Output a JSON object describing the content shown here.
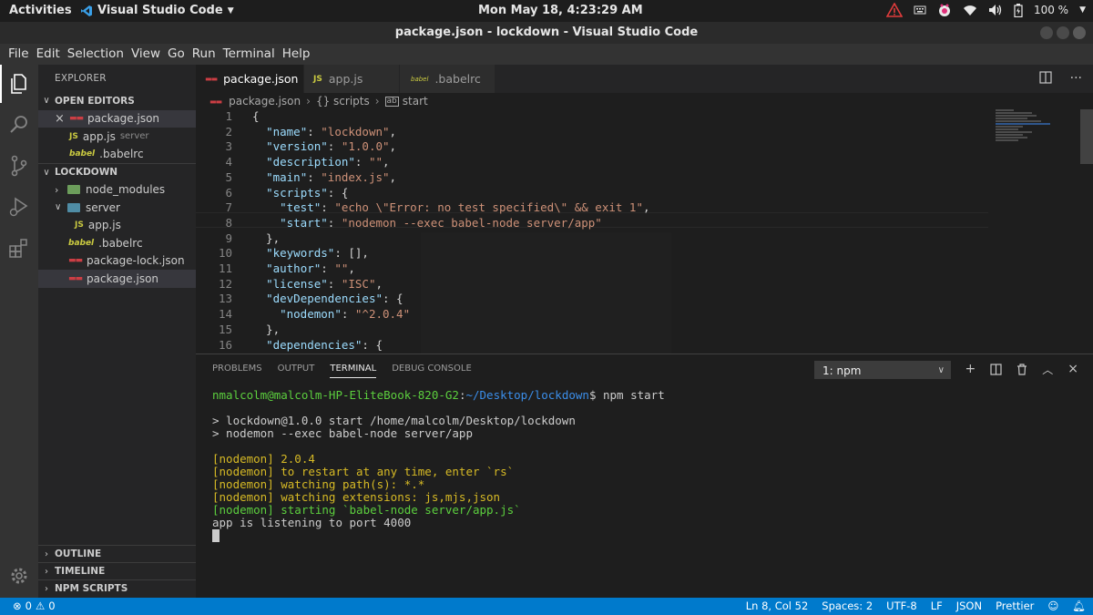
{
  "system": {
    "activities": "Activities",
    "app_name": "Visual Studio Code",
    "clock": "Mon May 18,  4:23:29 AM",
    "battery": "100 %"
  },
  "window": {
    "title": "package.json - lockdown - Visual Studio Code"
  },
  "menu": [
    "File",
    "Edit",
    "Selection",
    "View",
    "Go",
    "Run",
    "Terminal",
    "Help"
  ],
  "sidebar": {
    "title": "EXPLORER",
    "open_editors": {
      "header": "OPEN EDITORS",
      "items": [
        {
          "name": "package.json",
          "desc": ""
        },
        {
          "name": "app.js",
          "desc": "server"
        },
        {
          "name": ".babelrc",
          "desc": ""
        }
      ]
    },
    "project": {
      "header": "LOCKDOWN",
      "items": [
        {
          "name": "node_modules"
        },
        {
          "name": "server"
        },
        {
          "name": "app.js"
        },
        {
          "name": ".babelrc"
        },
        {
          "name": "package-lock.json"
        },
        {
          "name": "package.json"
        }
      ]
    },
    "bottom_sections": [
      "OUTLINE",
      "TIMELINE",
      "NPM SCRIPTS"
    ]
  },
  "tabs": [
    {
      "label": "package.json",
      "icon": "json-file-icon"
    },
    {
      "label": "app.js",
      "icon": "js-file-icon"
    },
    {
      "label": ".babelrc",
      "icon": "babel-file-icon"
    }
  ],
  "breadcrumb": [
    "package.json",
    "{} scripts",
    "start"
  ],
  "editor": {
    "line_numbers": [
      "1",
      "2",
      "3",
      "4",
      "5",
      "6",
      "7",
      "8",
      "9",
      "10",
      "11",
      "12",
      "13",
      "14",
      "15",
      "16"
    ],
    "lines": [
      "{",
      "  \"name\": \"lockdown\",",
      "  \"version\": \"1.0.0\",",
      "  \"description\": \"\",",
      "  \"main\": \"index.js\",",
      "  \"scripts\": {",
      "    \"test\": \"echo \\\"Error: no test specified\\\" && exit 1\",",
      "    \"start\": \"nodemon --exec babel-node server/app\"",
      "  },",
      "  \"keywords\": [],",
      "  \"author\": \"\",",
      "  \"license\": \"ISC\",",
      "  \"devDependencies\": {",
      "    \"nodemon\": \"^2.0.4\"",
      "  },",
      "  \"dependencies\": {"
    ]
  },
  "panel": {
    "tabs": [
      "PROBLEMS",
      "OUTPUT",
      "TERMINAL",
      "DEBUG CONSOLE"
    ],
    "active_tab": "TERMINAL",
    "terminal_select": "1: npm",
    "terminal": {
      "prompt_user": "nmalcolm@malcolm-HP-EliteBook-820-G2",
      "prompt_path": "~/Desktop/lockdown",
      "prompt_cmd": "$ npm start",
      "run1": "> lockdown@1.0.0 start /home/malcolm/Desktop/lockdown",
      "run2": "> nodemon --exec babel-node server/app",
      "nm1": "[nodemon] 2.0.4",
      "nm2": "[nodemon] to restart at any time, enter `rs`",
      "nm3": "[nodemon] watching path(s): *.*",
      "nm4": "[nodemon] watching extensions: js,mjs,json",
      "nm5": "[nodemon] starting `babel-node server/app.js`",
      "out": "app is listening to port 4000"
    }
  },
  "status": {
    "problems": "0",
    "warnings": "0",
    "cursor": "Ln 8, Col 52",
    "spaces": "Spaces: 2",
    "encoding": "UTF-8",
    "eol": "LF",
    "language": "JSON",
    "formatter": "Prettier"
  },
  "colors": {
    "accent": "#007acc",
    "string": "#ce9178",
    "key": "#9cdcfe"
  }
}
